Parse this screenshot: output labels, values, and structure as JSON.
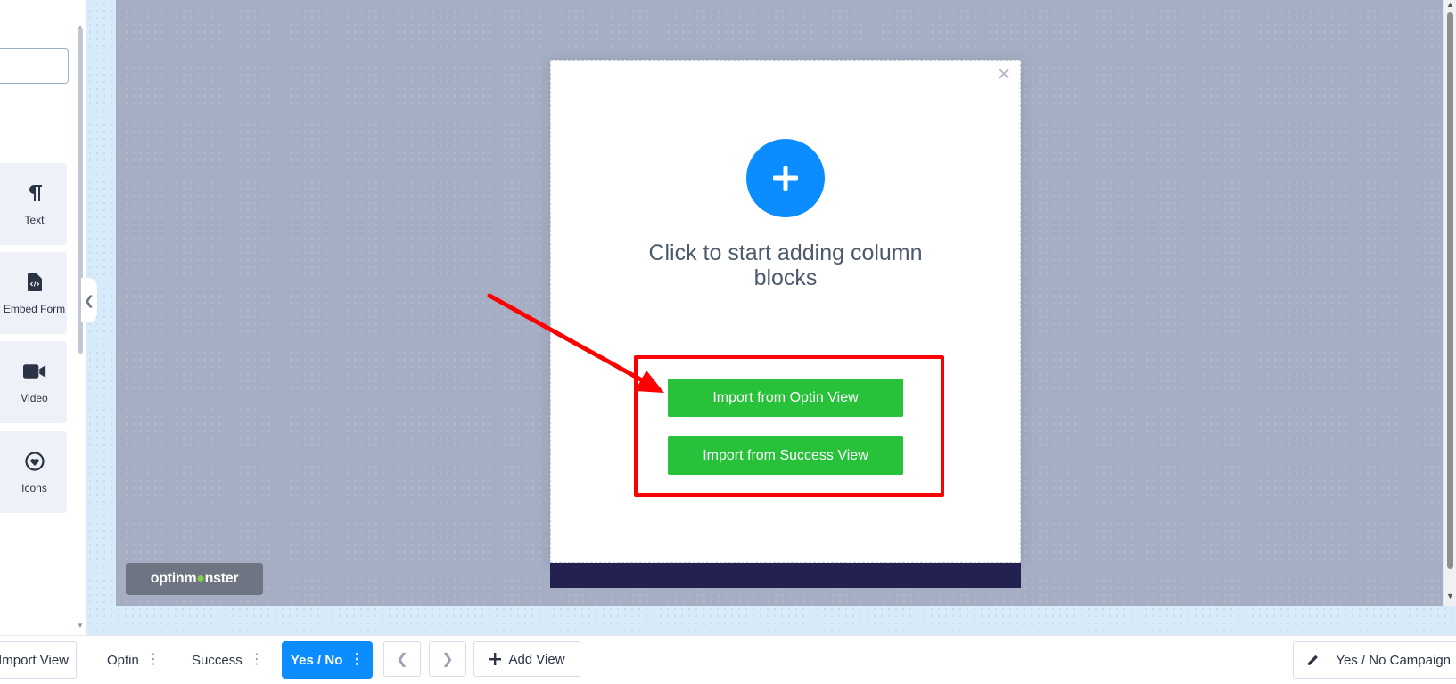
{
  "sidebar": {
    "search": {
      "value": "",
      "placeholder": ""
    },
    "blocks": [
      {
        "label": "Text",
        "icon": "paragraph-icon"
      },
      {
        "label": "Embed Form",
        "icon": "file-code-icon"
      },
      {
        "label": "Video",
        "icon": "video-camera-icon"
      },
      {
        "label": "Icons",
        "icon": "heart-circle-icon"
      }
    ]
  },
  "popup": {
    "heading": "Click to start adding column blocks",
    "import_optin_label": "Import from Optin View",
    "import_success_label": "Import from Success View"
  },
  "brand": {
    "text_before": "optinm",
    "text_after": "nster"
  },
  "bottom_bar": {
    "import_view_label": "Import View",
    "tabs": [
      {
        "label": "Optin",
        "active": false
      },
      {
        "label": "Success",
        "active": false
      },
      {
        "label": "Yes / No",
        "active": true
      }
    ],
    "add_view_label": "Add View",
    "campaign_label": "Yes / No Campaign"
  },
  "colors": {
    "accent": "#0b8cff",
    "import_button": "#27c13a",
    "highlight": "#ff0000",
    "canvas": "#a5aec3",
    "popup_footer": "#23214f"
  }
}
